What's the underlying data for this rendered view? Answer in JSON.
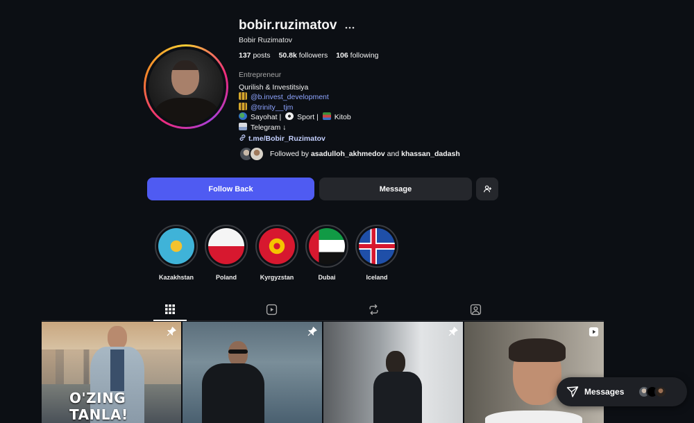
{
  "profile": {
    "username": "bobir.ruzimatov",
    "full_name": "Bobir Ruzimatov",
    "more_icon": "ellipsis-icon"
  },
  "stats": {
    "posts_count": "137",
    "posts_label": "posts",
    "followers_count": "50.8k",
    "followers_label": "followers",
    "following_count": "106",
    "following_label": "following"
  },
  "bio": {
    "category": "Entrepreneur",
    "line1": "Qurilish & Investitsiya",
    "mention1": "@b.invest_development",
    "mention2": "@trinity__tjm",
    "line4_a": "Sayohat |",
    "line4_b": "Sport |",
    "line4_c": "Kitob",
    "line5": "Telegram ↓",
    "link": "t.me/Bobir_Ruzimatov"
  },
  "followed_by": {
    "prefix": "Followed by",
    "user1": "asadulloh_akhmedov",
    "and": "and",
    "user2": "khassan_dadash"
  },
  "actions": {
    "follow_back": "Follow Back",
    "message": "Message",
    "add_user_icon": "add-user-icon"
  },
  "highlights": [
    {
      "label": "Kazakhstan"
    },
    {
      "label": "Poland"
    },
    {
      "label": "Kyrgyzstan"
    },
    {
      "label": "Dubai"
    },
    {
      "label": "Iceland"
    }
  ],
  "tabs": [
    {
      "icon": "grid-icon",
      "active": true
    },
    {
      "icon": "reels-icon",
      "active": false
    },
    {
      "icon": "reposts-icon",
      "active": false
    },
    {
      "icon": "tagged-icon",
      "active": false
    }
  ],
  "posts": [
    {
      "caption": "O'ZING TANLA!",
      "badge": "pin-icon"
    },
    {
      "badge": "pin-icon"
    },
    {
      "badge": "pin-icon"
    },
    {
      "badge": "reel-icon"
    }
  ],
  "messages": {
    "label": "Messages",
    "icon": "send-icon"
  },
  "colors": {
    "background": "#0c0f14",
    "primary_button": "#4f5bf2",
    "secondary_button": "#25272c",
    "link": "#8ea4ff"
  }
}
